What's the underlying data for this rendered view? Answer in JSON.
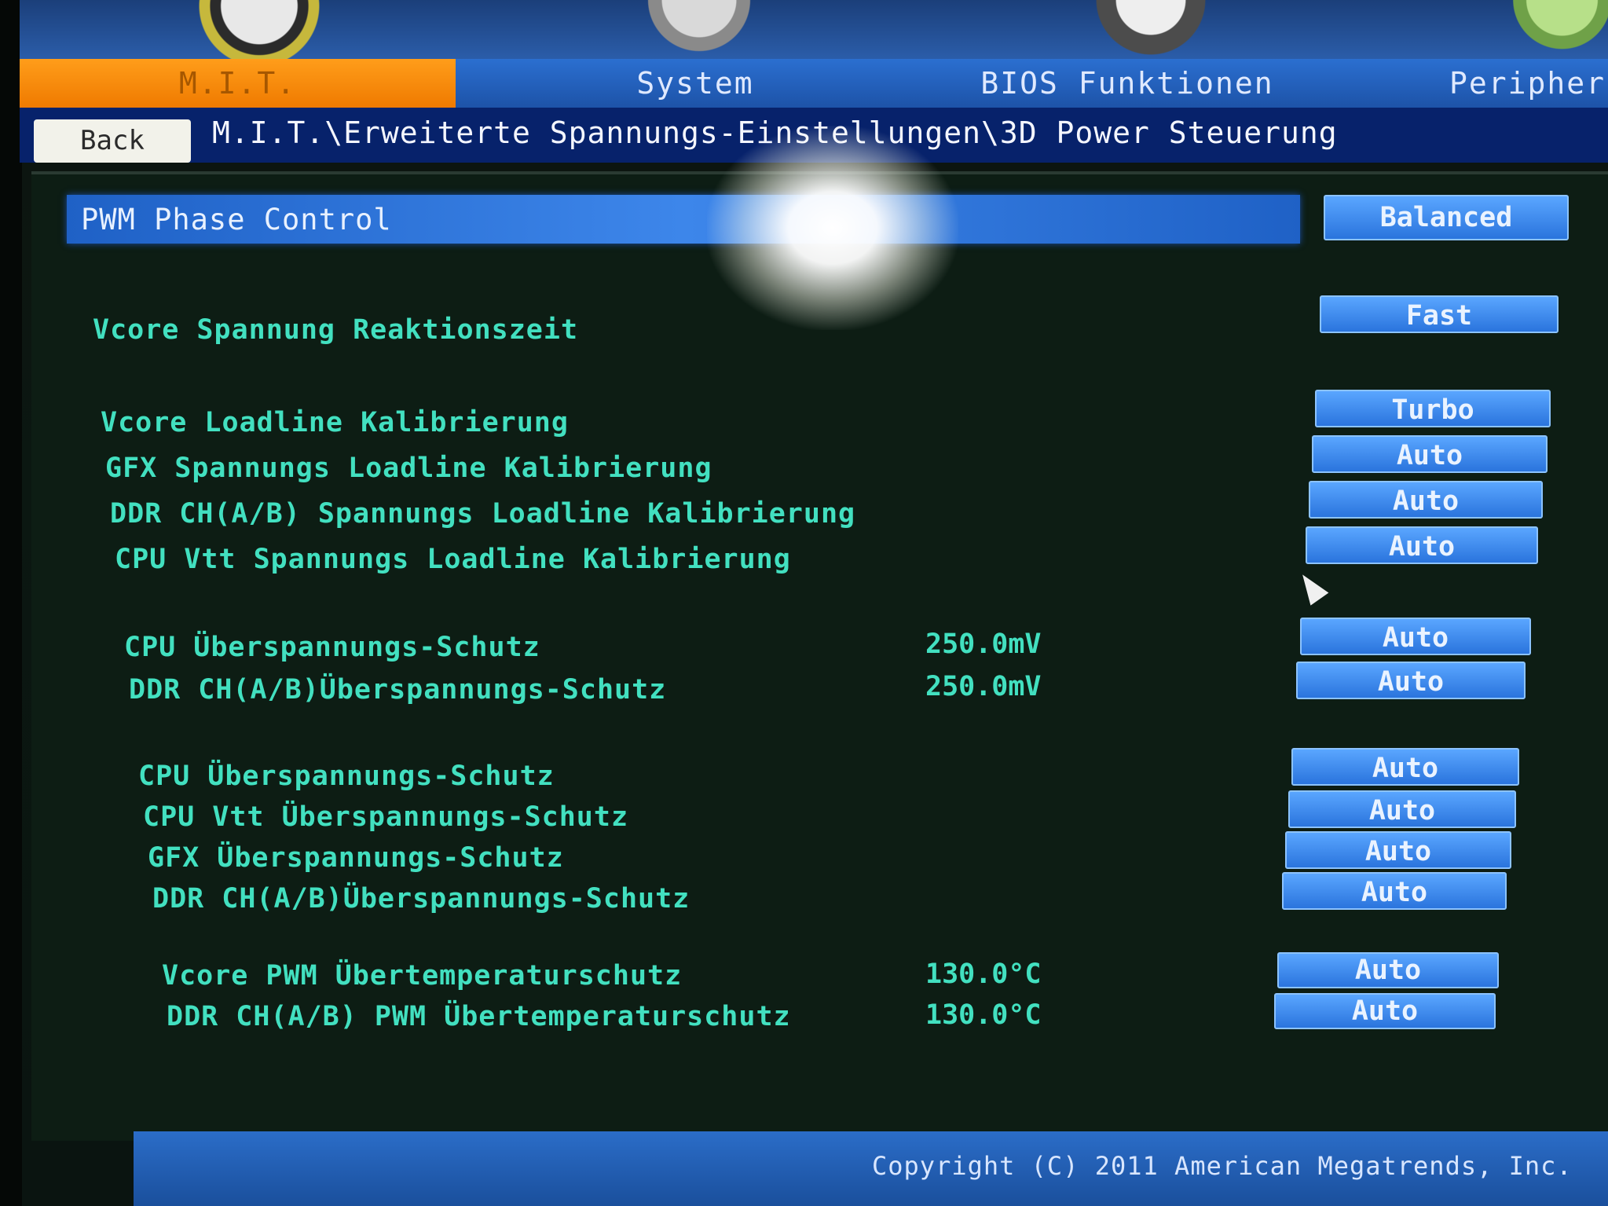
{
  "tabs": {
    "mit": "M.I.T.",
    "system": "System",
    "bios": "BIOS Funktionen",
    "peripherals": "Peripher"
  },
  "breadcrumb": {
    "back_label": "Back",
    "path": "M.I.T.\\Erweiterte Spannungs-Einstellungen\\3D Power Steuerung"
  },
  "section": {
    "title": "PWM Phase Control",
    "value": "Balanced"
  },
  "rows": [
    {
      "label": "Vcore Spannung Reaktionszeit",
      "reading": "",
      "value": "Fast"
    },
    {
      "label": "Vcore Loadline Kalibrierung",
      "reading": "",
      "value": "Turbo"
    },
    {
      "label": "GFX Spannungs Loadline Kalibrierung",
      "reading": "",
      "value": "Auto"
    },
    {
      "label": "DDR CH(A/B) Spannungs Loadline Kalibrierung",
      "reading": "",
      "value": "Auto"
    },
    {
      "label": "CPU Vtt Spannungs Loadline Kalibrierung",
      "reading": "",
      "value": "Auto"
    },
    {
      "label": "CPU Überspannungs-Schutz",
      "reading": "250.0mV",
      "value": "Auto"
    },
    {
      "label": "DDR CH(A/B)Überspannungs-Schutz",
      "reading": "250.0mV",
      "value": "Auto"
    },
    {
      "label": "CPU Überspannungs-Schutz",
      "reading": "",
      "value": "Auto"
    },
    {
      "label": "CPU Vtt Überspannungs-Schutz",
      "reading": "",
      "value": "Auto"
    },
    {
      "label": "GFX Überspannungs-Schutz",
      "reading": "",
      "value": "Auto"
    },
    {
      "label": "DDR CH(A/B)Überspannungs-Schutz",
      "reading": "",
      "value": "Auto"
    },
    {
      "label": "Vcore PWM Übertemperaturschutz",
      "reading": "130.0°C",
      "value": "Auto"
    },
    {
      "label": "DDR CH(A/B) PWM Übertemperaturschutz",
      "reading": "130.0°C",
      "value": "Auto"
    }
  ],
  "footer": {
    "copyright": "Copyright (C) 2011 American Megatrends, Inc."
  },
  "colors": {
    "accent_tab": "#ef7a00",
    "button": "#2a74dd",
    "label_text": "#42e0c0"
  }
}
